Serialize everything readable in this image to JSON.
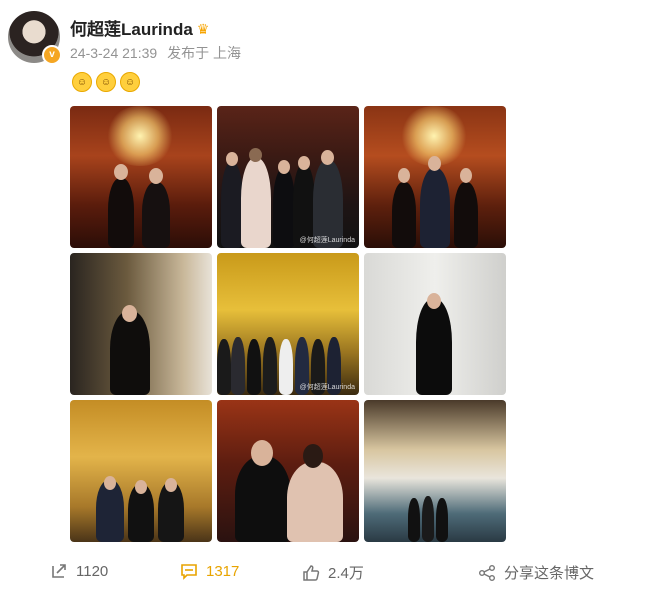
{
  "post": {
    "username": "何超莲Laurinda",
    "time": "24-3-24 21:39",
    "source": "发布于 上海",
    "verified_badge": "v",
    "emojis": [
      "face-emoji-1",
      "face-emoji-2",
      "face-emoji-3"
    ]
  },
  "photos": {
    "watermark_2": "@何超莲Laurinda",
    "watermark_5": "@何超莲Laurinda"
  },
  "actions": {
    "repost_count": "1120",
    "comment_count": "1317",
    "like_count": "2.4万",
    "share_label": "分享这条博文"
  },
  "colors": {
    "accent_orange": "#e8a400",
    "meta_gray": "#939393"
  }
}
